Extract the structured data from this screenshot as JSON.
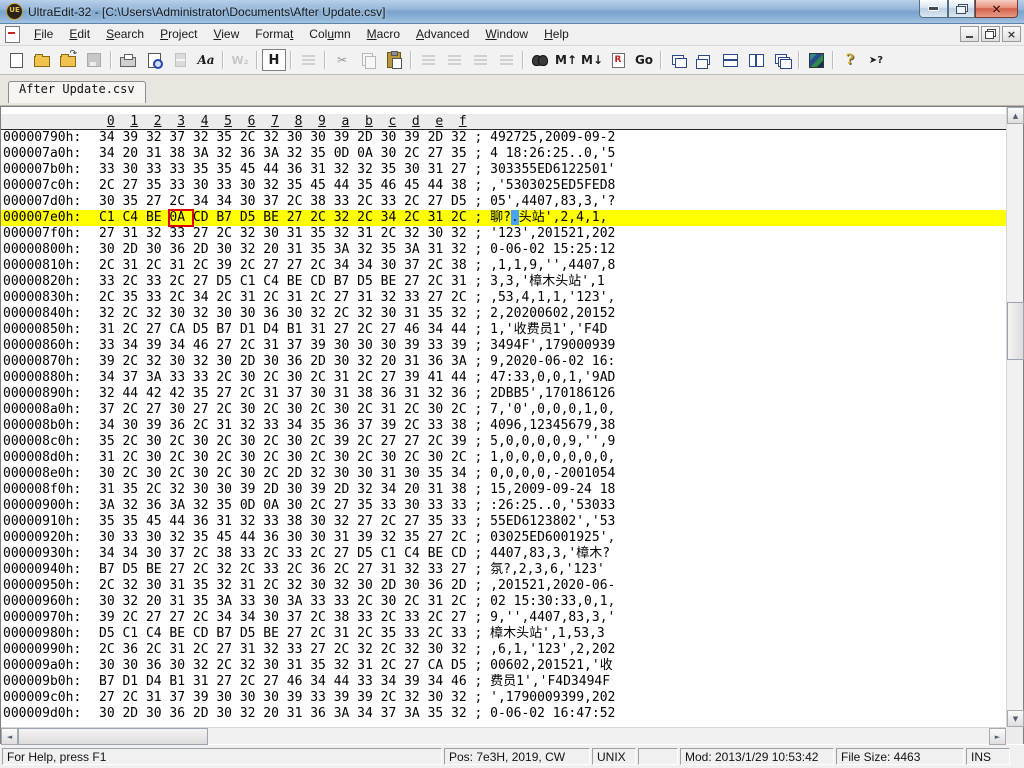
{
  "window": {
    "title": "UltraEdit-32 - [C:\\Users\\Administrator\\Documents\\After Update.csv]",
    "icon_text": "UE"
  },
  "menu": {
    "items": [
      {
        "label": "File",
        "accel_index": 0
      },
      {
        "label": "Edit",
        "accel_index": 0
      },
      {
        "label": "Search",
        "accel_index": 0
      },
      {
        "label": "Project",
        "accel_index": 0
      },
      {
        "label": "View",
        "accel_index": 0
      },
      {
        "label": "Format",
        "accel_index": 5
      },
      {
        "label": "Column",
        "accel_index": 3
      },
      {
        "label": "Macro",
        "accel_index": 0
      },
      {
        "label": "Advanced",
        "accel_index": 0
      },
      {
        "label": "Window",
        "accel_index": 0
      },
      {
        "label": "Help",
        "accel_index": 0
      }
    ]
  },
  "toolbar": {
    "items": [
      {
        "name": "new-file-button",
        "icon": "page",
        "state": "normal"
      },
      {
        "name": "open-file-button",
        "icon": "folder-open",
        "state": "normal"
      },
      {
        "name": "quick-open-button",
        "icon": "folder-arrow",
        "state": "normal"
      },
      {
        "name": "save-button",
        "icon": "floppy",
        "state": "disabled"
      },
      {
        "sep": true
      },
      {
        "name": "print-button",
        "icon": "printer",
        "state": "normal"
      },
      {
        "name": "print-preview-button",
        "icon": "preview",
        "state": "normal"
      },
      {
        "name": "print-setup-button",
        "icon": "blocks",
        "state": "disabled"
      },
      {
        "name": "font-button",
        "icon": "aa",
        "glyph": "Aa",
        "state": "normal"
      },
      {
        "sep": true
      },
      {
        "name": "word-wrap-button",
        "icon": "wrapw",
        "glyph": "W₂",
        "state": "disabled"
      },
      {
        "sep": true
      },
      {
        "name": "hex-mode-button",
        "icon": "hexH",
        "glyph": "H",
        "state": "active"
      },
      {
        "sep": true
      },
      {
        "name": "paragraph-format-button",
        "icon": "align-lines",
        "state": "disabled"
      },
      {
        "sep": true
      },
      {
        "name": "cut-button",
        "icon": "text",
        "glyph": "✂",
        "state": "disabled"
      },
      {
        "name": "copy-button",
        "icon": "copy",
        "state": "disabled"
      },
      {
        "name": "paste-button",
        "icon": "paste",
        "state": "normal"
      },
      {
        "sep": true
      },
      {
        "name": "align-left-button",
        "icon": "align-lines",
        "state": "disabled"
      },
      {
        "name": "align-center-button",
        "icon": "align-lines",
        "state": "disabled"
      },
      {
        "name": "align-right-button",
        "icon": "align-lines",
        "state": "disabled"
      },
      {
        "name": "align-justify-button",
        "icon": "align-lines",
        "state": "disabled"
      },
      {
        "sep": true
      },
      {
        "name": "find-button",
        "icon": "binoculars",
        "state": "normal"
      },
      {
        "name": "find-prev-button",
        "icon": "text",
        "glyph": "M↑",
        "state": "normal"
      },
      {
        "name": "find-next-button",
        "icon": "text",
        "glyph": "M↓",
        "state": "normal"
      },
      {
        "name": "replace-button",
        "icon": "replace",
        "glyph": "R",
        "state": "normal"
      },
      {
        "name": "goto-button",
        "icon": "text",
        "glyph": "Go",
        "state": "normal"
      },
      {
        "sep": true
      },
      {
        "name": "cascade-windows-button",
        "icon": "win-cascade",
        "state": "normal"
      },
      {
        "name": "tile-windows-button",
        "icon": "win-tile",
        "state": "normal"
      },
      {
        "name": "split-horizontal-button",
        "icon": "win-split-h",
        "state": "normal"
      },
      {
        "name": "split-vertical-button",
        "icon": "win-split-v",
        "state": "normal"
      },
      {
        "name": "arrange-windows-button",
        "icon": "win-stack",
        "state": "normal"
      },
      {
        "sep": true
      },
      {
        "name": "color-settings-button",
        "icon": "colors",
        "state": "normal"
      },
      {
        "sep": true
      },
      {
        "name": "help-button",
        "icon": "help-q",
        "glyph": "?",
        "state": "normal"
      },
      {
        "name": "context-help-button",
        "icon": "ctx-help",
        "glyph": "➤?",
        "state": "normal"
      }
    ]
  },
  "tabs": [
    {
      "label": "After Update.csv",
      "active": true
    }
  ],
  "colors": {
    "highlight_row": "#ffff00",
    "selection": "#47a3ff",
    "red_box": "#e00000",
    "titlebar_blue": "#7aa2cc"
  },
  "hex": {
    "ruler_columns": [
      "0",
      "1",
      "2",
      "3",
      "4",
      "5",
      "6",
      "7",
      "8",
      "9",
      "a",
      "b",
      "c",
      "d",
      "e",
      "f"
    ],
    "rows": [
      {
        "offset": "00000790h:",
        "bytes": [
          "34",
          "39",
          "32",
          "37",
          "32",
          "35",
          "2C",
          "32",
          "30",
          "30",
          "39",
          "2D",
          "30",
          "39",
          "2D",
          "32"
        ],
        "ascii": "492725,2009-09-2"
      },
      {
        "offset": "000007a0h:",
        "bytes": [
          "34",
          "20",
          "31",
          "38",
          "3A",
          "32",
          "36",
          "3A",
          "32",
          "35",
          "0D",
          "0A",
          "30",
          "2C",
          "27",
          "35"
        ],
        "ascii": "4 18:26:25..0,'5"
      },
      {
        "offset": "000007b0h:",
        "bytes": [
          "33",
          "30",
          "33",
          "33",
          "35",
          "35",
          "45",
          "44",
          "36",
          "31",
          "32",
          "32",
          "35",
          "30",
          "31",
          "27"
        ],
        "ascii": "303355ED6122501'"
      },
      {
        "offset": "000007c0h:",
        "bytes": [
          "2C",
          "27",
          "35",
          "33",
          "30",
          "33",
          "30",
          "32",
          "35",
          "45",
          "44",
          "35",
          "46",
          "45",
          "44",
          "38"
        ],
        "ascii": ",'5303025ED5FED8"
      },
      {
        "offset": "000007d0h:",
        "bytes": [
          "30",
          "35",
          "27",
          "2C",
          "34",
          "34",
          "30",
          "37",
          "2C",
          "38",
          "33",
          "2C",
          "33",
          "2C",
          "27",
          "D5"
        ],
        "ascii": "05',4407,83,3,'?"
      },
      {
        "offset": "000007e0h:",
        "highlight": true,
        "red_box_byte_index": 3,
        "bytes": [
          "C1",
          "C4",
          "BE",
          "0A",
          "CD",
          "B7",
          "D5",
          "BE",
          "27",
          "2C",
          "32",
          "2C",
          "34",
          "2C",
          "31",
          "2C"
        ],
        "ascii_segments": [
          {
            "text": "聊?"
          },
          {
            "text": ".",
            "selected": true
          },
          {
            "text": "头站',2,4,1,"
          }
        ]
      },
      {
        "offset": "000007f0h:",
        "bytes": [
          "27",
          "31",
          "32",
          "33",
          "27",
          "2C",
          "32",
          "30",
          "31",
          "35",
          "32",
          "31",
          "2C",
          "32",
          "30",
          "32"
        ],
        "ascii": "'123',201521,202"
      },
      {
        "offset": "00000800h:",
        "bytes": [
          "30",
          "2D",
          "30",
          "36",
          "2D",
          "30",
          "32",
          "20",
          "31",
          "35",
          "3A",
          "32",
          "35",
          "3A",
          "31",
          "32"
        ],
        "ascii": "0-06-02 15:25:12"
      },
      {
        "offset": "00000810h:",
        "bytes": [
          "2C",
          "31",
          "2C",
          "31",
          "2C",
          "39",
          "2C",
          "27",
          "27",
          "2C",
          "34",
          "34",
          "30",
          "37",
          "2C",
          "38"
        ],
        "ascii": ",1,1,9,'',4407,8"
      },
      {
        "offset": "00000820h:",
        "bytes": [
          "33",
          "2C",
          "33",
          "2C",
          "27",
          "D5",
          "C1",
          "C4",
          "BE",
          "CD",
          "B7",
          "D5",
          "BE",
          "27",
          "2C",
          "31"
        ],
        "ascii": "3,3,'樟木头站',1"
      },
      {
        "offset": "00000830h:",
        "bytes": [
          "2C",
          "35",
          "33",
          "2C",
          "34",
          "2C",
          "31",
          "2C",
          "31",
          "2C",
          "27",
          "31",
          "32",
          "33",
          "27",
          "2C"
        ],
        "ascii": ",53,4,1,1,'123',"
      },
      {
        "offset": "00000840h:",
        "bytes": [
          "32",
          "2C",
          "32",
          "30",
          "32",
          "30",
          "30",
          "36",
          "30",
          "32",
          "2C",
          "32",
          "30",
          "31",
          "35",
          "32"
        ],
        "ascii": "2,20200602,20152"
      },
      {
        "offset": "00000850h:",
        "bytes": [
          "31",
          "2C",
          "27",
          "CA",
          "D5",
          "B7",
          "D1",
          "D4",
          "B1",
          "31",
          "27",
          "2C",
          "27",
          "46",
          "34",
          "44"
        ],
        "ascii": "1,'收费员1','F4D"
      },
      {
        "offset": "00000860h:",
        "bytes": [
          "33",
          "34",
          "39",
          "34",
          "46",
          "27",
          "2C",
          "31",
          "37",
          "39",
          "30",
          "30",
          "30",
          "39",
          "33",
          "39"
        ],
        "ascii": "3494F',179000939"
      },
      {
        "offset": "00000870h:",
        "bytes": [
          "39",
          "2C",
          "32",
          "30",
          "32",
          "30",
          "2D",
          "30",
          "36",
          "2D",
          "30",
          "32",
          "20",
          "31",
          "36",
          "3A"
        ],
        "ascii": "9,2020-06-02 16:"
      },
      {
        "offset": "00000880h:",
        "bytes": [
          "34",
          "37",
          "3A",
          "33",
          "33",
          "2C",
          "30",
          "2C",
          "30",
          "2C",
          "31",
          "2C",
          "27",
          "39",
          "41",
          "44"
        ],
        "ascii": "47:33,0,0,1,'9AD"
      },
      {
        "offset": "00000890h:",
        "bytes": [
          "32",
          "44",
          "42",
          "42",
          "35",
          "27",
          "2C",
          "31",
          "37",
          "30",
          "31",
          "38",
          "36",
          "31",
          "32",
          "36"
        ],
        "ascii": "2DBB5',170186126"
      },
      {
        "offset": "000008a0h:",
        "bytes": [
          "37",
          "2C",
          "27",
          "30",
          "27",
          "2C",
          "30",
          "2C",
          "30",
          "2C",
          "30",
          "2C",
          "31",
          "2C",
          "30",
          "2C"
        ],
        "ascii": "7,'0',0,0,0,1,0,"
      },
      {
        "offset": "000008b0h:",
        "bytes": [
          "34",
          "30",
          "39",
          "36",
          "2C",
          "31",
          "32",
          "33",
          "34",
          "35",
          "36",
          "37",
          "39",
          "2C",
          "33",
          "38"
        ],
        "ascii": "4096,12345679,38"
      },
      {
        "offset": "000008c0h:",
        "bytes": [
          "35",
          "2C",
          "30",
          "2C",
          "30",
          "2C",
          "30",
          "2C",
          "30",
          "2C",
          "39",
          "2C",
          "27",
          "27",
          "2C",
          "39"
        ],
        "ascii": "5,0,0,0,0,9,'',9"
      },
      {
        "offset": "000008d0h:",
        "bytes": [
          "31",
          "2C",
          "30",
          "2C",
          "30",
          "2C",
          "30",
          "2C",
          "30",
          "2C",
          "30",
          "2C",
          "30",
          "2C",
          "30",
          "2C"
        ],
        "ascii": "1,0,0,0,0,0,0,0,"
      },
      {
        "offset": "000008e0h:",
        "bytes": [
          "30",
          "2C",
          "30",
          "2C",
          "30",
          "2C",
          "30",
          "2C",
          "2D",
          "32",
          "30",
          "30",
          "31",
          "30",
          "35",
          "34"
        ],
        "ascii": "0,0,0,0,-2001054"
      },
      {
        "offset": "000008f0h:",
        "bytes": [
          "31",
          "35",
          "2C",
          "32",
          "30",
          "30",
          "39",
          "2D",
          "30",
          "39",
          "2D",
          "32",
          "34",
          "20",
          "31",
          "38"
        ],
        "ascii": "15,2009-09-24 18"
      },
      {
        "offset": "00000900h:",
        "bytes": [
          "3A",
          "32",
          "36",
          "3A",
          "32",
          "35",
          "0D",
          "0A",
          "30",
          "2C",
          "27",
          "35",
          "33",
          "30",
          "33",
          "33"
        ],
        "ascii": ":26:25..0,'53033"
      },
      {
        "offset": "00000910h:",
        "bytes": [
          "35",
          "35",
          "45",
          "44",
          "36",
          "31",
          "32",
          "33",
          "38",
          "30",
          "32",
          "27",
          "2C",
          "27",
          "35",
          "33"
        ],
        "ascii": "55ED6123802','53"
      },
      {
        "offset": "00000920h:",
        "bytes": [
          "30",
          "33",
          "30",
          "32",
          "35",
          "45",
          "44",
          "36",
          "30",
          "30",
          "31",
          "39",
          "32",
          "35",
          "27",
          "2C"
        ],
        "ascii": "03025ED6001925',"
      },
      {
        "offset": "00000930h:",
        "bytes": [
          "34",
          "34",
          "30",
          "37",
          "2C",
          "38",
          "33",
          "2C",
          "33",
          "2C",
          "27",
          "D5",
          "C1",
          "C4",
          "BE",
          "CD"
        ],
        "ascii": "4407,83,3,'樟木?"
      },
      {
        "offset": "00000940h:",
        "bytes": [
          "B7",
          "D5",
          "BE",
          "27",
          "2C",
          "32",
          "2C",
          "33",
          "2C",
          "36",
          "2C",
          "27",
          "31",
          "32",
          "33",
          "27"
        ],
        "ascii": "氛?,2,3,6,'123'"
      },
      {
        "offset": "00000950h:",
        "bytes": [
          "2C",
          "32",
          "30",
          "31",
          "35",
          "32",
          "31",
          "2C",
          "32",
          "30",
          "32",
          "30",
          "2D",
          "30",
          "36",
          "2D"
        ],
        "ascii": ",201521,2020-06-"
      },
      {
        "offset": "00000960h:",
        "bytes": [
          "30",
          "32",
          "20",
          "31",
          "35",
          "3A",
          "33",
          "30",
          "3A",
          "33",
          "33",
          "2C",
          "30",
          "2C",
          "31",
          "2C"
        ],
        "ascii": "02 15:30:33,0,1,"
      },
      {
        "offset": "00000970h:",
        "bytes": [
          "39",
          "2C",
          "27",
          "27",
          "2C",
          "34",
          "34",
          "30",
          "37",
          "2C",
          "38",
          "33",
          "2C",
          "33",
          "2C",
          "27"
        ],
        "ascii": "9,'',4407,83,3,'"
      },
      {
        "offset": "00000980h:",
        "bytes": [
          "D5",
          "C1",
          "C4",
          "BE",
          "CD",
          "B7",
          "D5",
          "BE",
          "27",
          "2C",
          "31",
          "2C",
          "35",
          "33",
          "2C",
          "33"
        ],
        "ascii": "樟木头站',1,53,3"
      },
      {
        "offset": "00000990h:",
        "bytes": [
          "2C",
          "36",
          "2C",
          "31",
          "2C",
          "27",
          "31",
          "32",
          "33",
          "27",
          "2C",
          "32",
          "2C",
          "32",
          "30",
          "32"
        ],
        "ascii": ",6,1,'123',2,202"
      },
      {
        "offset": "000009a0h:",
        "bytes": [
          "30",
          "30",
          "36",
          "30",
          "32",
          "2C",
          "32",
          "30",
          "31",
          "35",
          "32",
          "31",
          "2C",
          "27",
          "CA",
          "D5"
        ],
        "ascii": "00602,201521,'收"
      },
      {
        "offset": "000009b0h:",
        "bytes": [
          "B7",
          "D1",
          "D4",
          "B1",
          "31",
          "27",
          "2C",
          "27",
          "46",
          "34",
          "44",
          "33",
          "34",
          "39",
          "34",
          "46"
        ],
        "ascii": "费员1','F4D3494F"
      },
      {
        "offset": "000009c0h:",
        "bytes": [
          "27",
          "2C",
          "31",
          "37",
          "39",
          "30",
          "30",
          "30",
          "39",
          "33",
          "39",
          "39",
          "2C",
          "32",
          "30",
          "32"
        ],
        "ascii": "',1790009399,202"
      },
      {
        "offset": "000009d0h:",
        "bytes": [
          "30",
          "2D",
          "30",
          "36",
          "2D",
          "30",
          "32",
          "20",
          "31",
          "36",
          "3A",
          "34",
          "37",
          "3A",
          "35",
          "32"
        ],
        "ascii": "0-06-02 16:47:52"
      }
    ]
  },
  "status_bar": {
    "segments": [
      {
        "name": "help-message",
        "text": "For Help, press F1"
      },
      {
        "name": "position-indicator",
        "text": "Pos: 7e3H, 2019, CW"
      },
      {
        "name": "line-ending-indicator",
        "text": "UNIX"
      },
      {
        "name": "spacer-segment",
        "text": ""
      },
      {
        "name": "modified-indicator",
        "text": "Mod: 2013/1/29 10:53:42"
      },
      {
        "name": "file-size-indicator",
        "text": "File Size: 4463"
      },
      {
        "name": "insert-mode-indicator",
        "text": "INS"
      }
    ]
  }
}
